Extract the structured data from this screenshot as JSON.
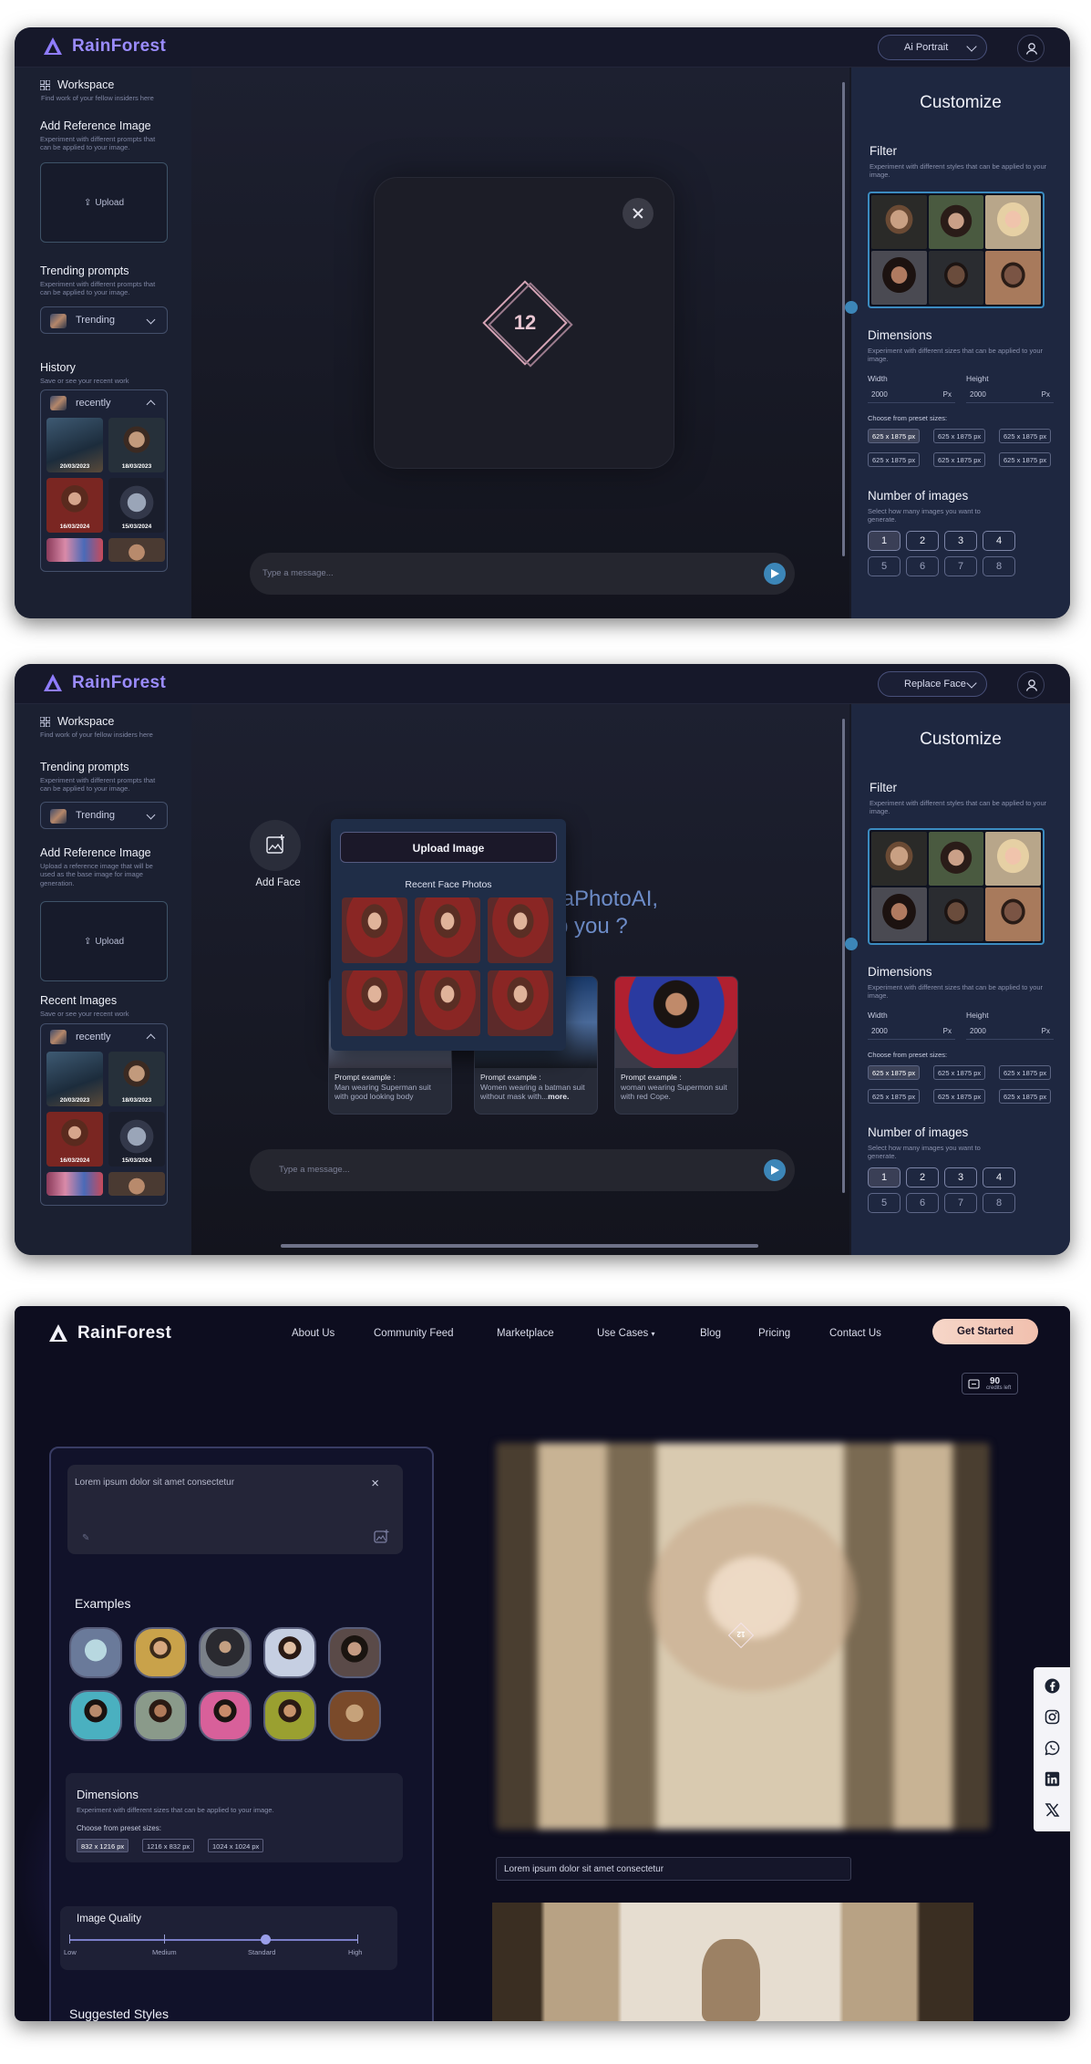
{
  "brand": {
    "name": "RainForest"
  },
  "screen1": {
    "mode": "Ai Portrait",
    "workspace": {
      "title": "Workspace",
      "sub": "Find work of your fellow insiders here"
    },
    "reference": {
      "title": "Add Reference Image",
      "sub": "Experiment with different prompts that can be applied to your image.",
      "upload": "Upload"
    },
    "trending": {
      "title": "Trending prompts",
      "sub": "Experiment with different prompts that can be applied to your image.",
      "value": "Trending"
    },
    "history": {
      "title": "History",
      "sub": "Save or see your recent work",
      "value": "recently",
      "tiles": [
        "20/03/2023",
        "18/03/2023",
        "16/03/2024",
        "15/03/2024",
        "",
        ""
      ]
    },
    "loader_number": "12",
    "message_placeholder": "Type a message..."
  },
  "customize": {
    "title": "Customize",
    "filter": {
      "title": "Filter",
      "sub": "Experiment with different styles that can be applied to your image."
    },
    "dimensions": {
      "title": "Dimensions",
      "sub": "Experiment with different sizes that can be applied to your image.",
      "width_label": "Width",
      "height_label": "Height",
      "width": "2000",
      "height": "2000",
      "unit": "Px",
      "preset_label": "Choose from preset sizes:",
      "presets": [
        "625 x 1875 px",
        "625 x 1875 px",
        "625 x 1875 px",
        "625 x 1875 px",
        "625 x 1875 px",
        "625 x 1875 px"
      ]
    },
    "images": {
      "title": "Number of images",
      "sub": "Select how many images you want to generate.",
      "options": [
        "1",
        "2",
        "3",
        "4",
        "5",
        "6",
        "7",
        "8"
      ]
    }
  },
  "screen2": {
    "mode": "Replace Face",
    "workspace": {
      "title": "Workspace",
      "sub": "Find work of your fellow insiders here"
    },
    "trending": {
      "title": "Trending prompts",
      "sub": "Experiment with different prompts that can be applied to your image.",
      "value": "Trending"
    },
    "reference": {
      "title": "Add Reference Image",
      "sub": "Upload a reference image that will be used as the base image for image generation.",
      "upload": "Upload"
    },
    "recent": {
      "title": "Recent Images",
      "sub": "Save or see your recent work",
      "value": "recently",
      "tiles": [
        "20/03/2023",
        "18/03/2023",
        "16/03/2024",
        "15/03/2024",
        "",
        ""
      ]
    },
    "add_face": "Add Face",
    "hero_line1": "taPhotoAI,",
    "hero_line2": "p you ?",
    "popup": {
      "upload": "Upload Image",
      "recent_title": "Recent Face Photos"
    },
    "cards": [
      {
        "title": "Prompt example :",
        "body": "Man wearing Superman suit with good looking body",
        "more": ""
      },
      {
        "title": "Prompt example :",
        "body": "Women wearing a batman suit without mask with...",
        "more": "more."
      },
      {
        "title": "Prompt example :",
        "body": "woman wearing Supermon suit with red Cope.",
        "more": ""
      }
    ],
    "message_placeholder": "Type a message..."
  },
  "screen3": {
    "nav": [
      "About Us",
      "Community Feed",
      "Marketplace",
      "Use Cases",
      "Blog",
      "Pricing",
      "Contact Us"
    ],
    "cta": "Get Started",
    "credits": {
      "value": "90",
      "label": "credits left"
    },
    "prompt_text": "Lorem ipsum dolor sit amet consectetur",
    "examples_title": "Examples",
    "dimensions": {
      "title": "Dimensions",
      "sub": "Experiment with different sizes that can be applied to your image.",
      "preset_label": "Choose from preset sizes:",
      "presets": [
        "832 x 1216 px",
        "1216 x 832 px",
        "1024 x 1024 px"
      ]
    },
    "quality": {
      "title": "Image Quality",
      "levels": [
        "Low",
        "Medium",
        "Standard",
        "High"
      ],
      "selected": "Standard"
    },
    "suggested_title": "Suggested Styles",
    "caption": "Lorem ipsum dolor sit amet consectetur",
    "image_number": "12",
    "social_icons": [
      "facebook-icon",
      "instagram-icon",
      "whatsapp-icon",
      "linkedin-icon",
      "x-icon"
    ]
  },
  "colors": {
    "accent": "#3c86b8",
    "brand": "#9b8cff",
    "cta": "#f1c0ae"
  }
}
